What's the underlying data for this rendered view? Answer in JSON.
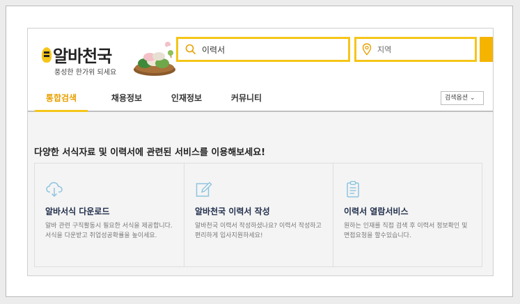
{
  "header": {
    "logo_text": "알바천국",
    "slogan": "풍성한 한가위 되세요",
    "search_value": "이력서",
    "region_placeholder": "지역"
  },
  "nav": {
    "tabs": [
      {
        "label": "통합검색",
        "active": true
      },
      {
        "label": "채용정보",
        "active": false
      },
      {
        "label": "인재정보",
        "active": false
      },
      {
        "label": "커뮤니티",
        "active": false
      }
    ],
    "search_option": "검색옵션 ⌄"
  },
  "main": {
    "headline": "다양한 서식자료 및 이력서에 관련된 서비스를 이용해보세요!",
    "cards": [
      {
        "icon": "cloud-download-icon",
        "title": "알바서식 다운로드",
        "desc": "알바 관련 구직활동시 필요한 서식을 제공합니다. 서식을 다운받고 취업성공확률을 높이세요."
      },
      {
        "icon": "edit-icon",
        "title": "알바천국 이력서 작성",
        "desc": "알바천국 이력서 작성하셨나요? 이력서 작성하고 편리하게 입사지원하세요!"
      },
      {
        "icon": "clipboard-icon",
        "title": "이력서 열람서비스",
        "desc": "원하는 인재를 직접 검색 후 이력서 정보확인 및 면접요청을 할수있습니다."
      }
    ]
  },
  "colors": {
    "accent": "#f5c518",
    "active_tab": "#e8a000",
    "card_title": "#1f2d4a"
  }
}
